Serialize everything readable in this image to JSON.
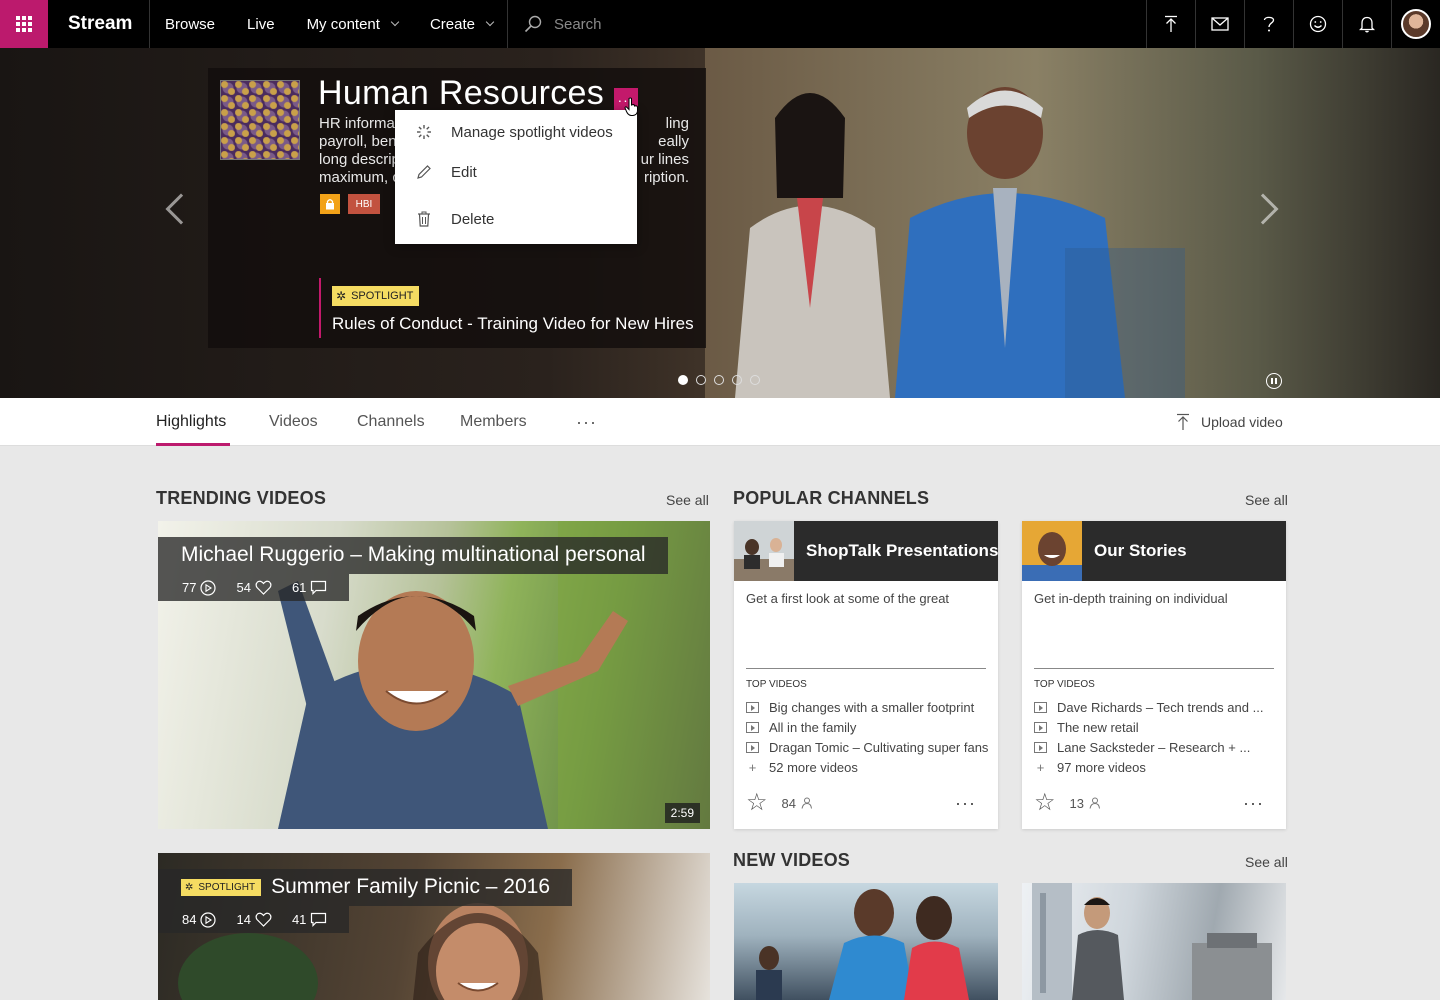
{
  "topbar": {
    "brand": "Stream",
    "nav": [
      "Browse",
      "Live",
      "My content",
      "Create"
    ],
    "search_placeholder": "Search"
  },
  "hero": {
    "title": "Human Resources",
    "description": "HR information ... payroll, ben... long descrip... maximum, c...",
    "description_lines": [
      "HR informa",
      "payroll, ben",
      "long descrip",
      "maximum, c"
    ],
    "description_tail_lines": [
      "ling",
      "eally",
      "ur lines",
      "ription."
    ],
    "badges": {
      "classification": "HBI"
    },
    "spotlight_label": "SPOTLIGHT",
    "spotlight_video": "Rules of Conduct - Training Video for New Hires",
    "carousel_dots": 5,
    "active_dot": 0
  },
  "menu": {
    "items": [
      {
        "label": "Manage spotlight videos",
        "icon": "spotlight-icon"
      },
      {
        "label": "Edit",
        "icon": "pencil-icon"
      },
      {
        "label": "Delete",
        "icon": "trash-icon"
      }
    ]
  },
  "tabs": {
    "items": [
      "Highlights",
      "Videos",
      "Channels",
      "Members"
    ],
    "active": "Highlights",
    "upload_label": "Upload video"
  },
  "trending": {
    "title": "TRENDING VIDEOS",
    "see_all": "See all",
    "videos": [
      {
        "title": "Michael Ruggerio – Making multinational personal",
        "views": "77",
        "likes": "54",
        "comments": "61",
        "duration": "2:59"
      },
      {
        "spotlight": "SPOTLIGHT",
        "title": "Summer Family Picnic – 2016",
        "views": "84",
        "likes": "14",
        "comments": "41"
      }
    ]
  },
  "popular_channels": {
    "title": "POPULAR CHANNELS",
    "see_all": "See all",
    "top_videos_label": "TOP VIDEOS",
    "channels": [
      {
        "name": "ShopTalk Presentations",
        "description": "Get a first look at some of the great",
        "videos": [
          "Big changes with a smaller footprint",
          "All in the family",
          "Dragan Tomic – Cultivating super fans"
        ],
        "more": "52  more videos",
        "followers": "84"
      },
      {
        "name": "Our Stories",
        "description": "Get in-depth training on individual",
        "videos": [
          "Dave Richards – Tech trends and ...",
          "The new retail",
          "Lane Sacksteder – Research + ..."
        ],
        "more": "97  more videos",
        "followers": "13"
      }
    ]
  },
  "new_videos": {
    "title": "NEW VIDEOS",
    "see_all": "See all"
  },
  "colors": {
    "brand": "#bc1a6d",
    "spotlight": "#f5dc62",
    "lock": "#f2a218",
    "hbi": "#c2523f"
  }
}
